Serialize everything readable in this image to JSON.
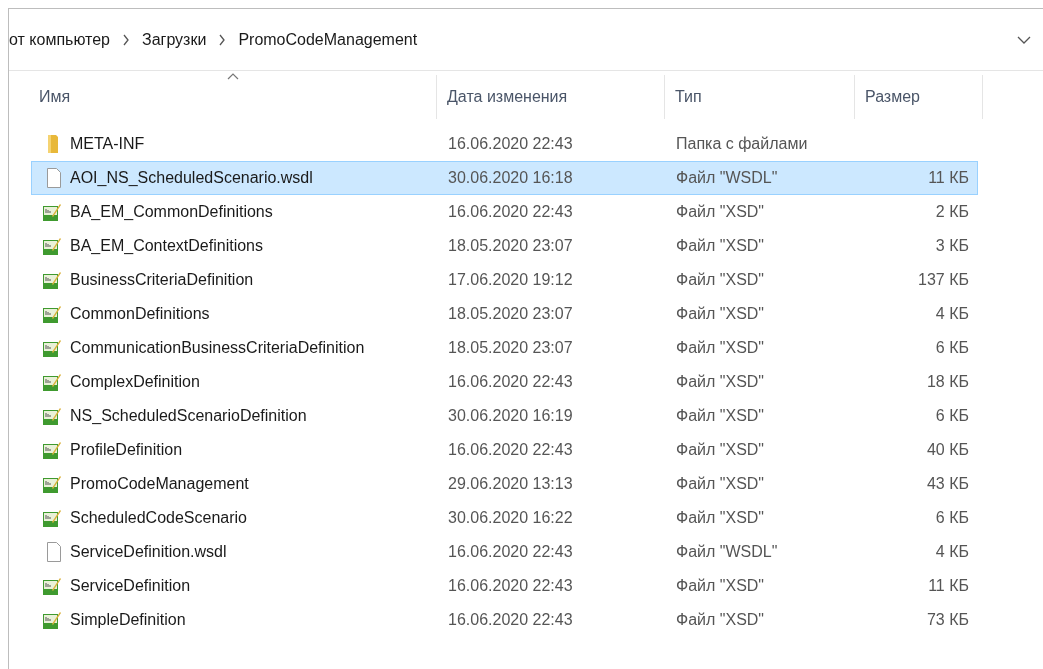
{
  "breadcrumb": [
    "от компьютер",
    "Загрузки",
    "PromoCodeManagement"
  ],
  "columns": [
    {
      "label": "Имя",
      "sorted": true
    },
    {
      "label": "Дата изменения",
      "sorted": false
    },
    {
      "label": "Тип",
      "sorted": false
    },
    {
      "label": "Размер",
      "sorted": false
    }
  ],
  "rows": [
    {
      "kind": "folder",
      "name": "META-INF",
      "date": "16.06.2020 22:43",
      "type": "Папка с файлами",
      "selected": false
    },
    {
      "kind": "file",
      "name": "AOI_NS_ScheduledScenario.wsdl",
      "date": "30.06.2020 16:18",
      "type": "Файл \"WSDL\"",
      "size": "11 КБ",
      "selected": true
    },
    {
      "kind": "xsd",
      "name": "BA_EM_CommonDefinitions",
      "date": "16.06.2020 22:43",
      "type": "Файл \"XSD\"",
      "size": "2 КБ",
      "selected": false
    },
    {
      "kind": "xsd",
      "name": "BA_EM_ContextDefinitions",
      "date": "18.05.2020 23:07",
      "type": "Файл \"XSD\"",
      "size": "3 КБ",
      "selected": false
    },
    {
      "kind": "xsd",
      "name": "BusinessCriteriaDefinition",
      "date": "17.06.2020 19:12",
      "type": "Файл \"XSD\"",
      "size": "137 КБ",
      "selected": false
    },
    {
      "kind": "xsd",
      "name": "CommonDefinitions",
      "date": "18.05.2020 23:07",
      "type": "Файл \"XSD\"",
      "size": "4 КБ",
      "selected": false
    },
    {
      "kind": "xsd",
      "name": "CommunicationBusinessCriteriaDefinition",
      "date": "18.05.2020 23:07",
      "type": "Файл \"XSD\"",
      "size": "6 КБ",
      "selected": false
    },
    {
      "kind": "xsd",
      "name": "ComplexDefinition",
      "date": "16.06.2020 22:43",
      "type": "Файл \"XSD\"",
      "size": "18 КБ",
      "selected": false
    },
    {
      "kind": "xsd",
      "name": "NS_ScheduledScenarioDefinition",
      "date": "30.06.2020 16:19",
      "type": "Файл \"XSD\"",
      "size": "6 КБ",
      "selected": false
    },
    {
      "kind": "xsd",
      "name": "ProfileDefinition",
      "date": "16.06.2020 22:43",
      "type": "Файл \"XSD\"",
      "size": "40 КБ",
      "selected": false
    },
    {
      "kind": "xsd",
      "name": "PromoCodeManagement",
      "date": "29.06.2020 13:13",
      "type": "Файл \"XSD\"",
      "size": "43 КБ",
      "selected": false
    },
    {
      "kind": "xsd",
      "name": "ScheduledCodeScenario",
      "date": "30.06.2020 16:22",
      "type": "Файл \"XSD\"",
      "size": "6 КБ",
      "selected": false
    },
    {
      "kind": "file",
      "name": "ServiceDefinition.wsdl",
      "date": "16.06.2020 22:43",
      "type": "Файл \"WSDL\"",
      "size": "4 КБ",
      "selected": false
    },
    {
      "kind": "xsd",
      "name": "ServiceDefinition",
      "date": "16.06.2020 22:43",
      "type": "Файл \"XSD\"",
      "size": "11 КБ",
      "selected": false
    },
    {
      "kind": "xsd",
      "name": "SimpleDefinition",
      "date": "16.06.2020 22:43",
      "type": "Файл \"XSD\"",
      "size": "73 КБ",
      "selected": false
    }
  ]
}
